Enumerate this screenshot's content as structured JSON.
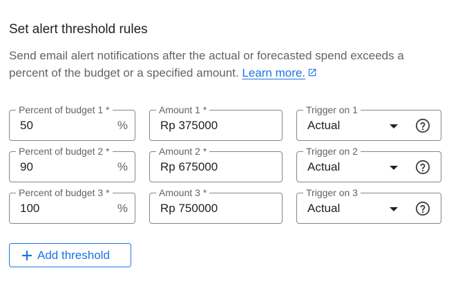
{
  "heading": "Set alert threshold rules",
  "description": "Send email alert notifications after the actual or forecasted spend exceeds a percent of the budget or a specified amount.",
  "learn_more": "Learn more.",
  "rows": [
    {
      "percent_label": "Percent of budget 1 *",
      "percent_value": "50",
      "percent_suffix": "%",
      "amount_label": "Amount 1 *",
      "amount_value": "Rp 375000",
      "trigger_label": "Trigger on 1",
      "trigger_value": "Actual"
    },
    {
      "percent_label": "Percent of budget 2 *",
      "percent_value": "90",
      "percent_suffix": "%",
      "amount_label": "Amount 2 *",
      "amount_value": "Rp 675000",
      "trigger_label": "Trigger on 2",
      "trigger_value": "Actual"
    },
    {
      "percent_label": "Percent of budget 3 *",
      "percent_value": "100",
      "percent_suffix": "%",
      "amount_label": "Amount 3 *",
      "amount_value": "Rp 750000",
      "trigger_label": "Trigger on 3",
      "trigger_value": "Actual"
    }
  ],
  "add_button": "Add threshold",
  "icons": {
    "external": "external-link-icon",
    "help": "help-circle-icon",
    "dropdown": "dropdown-arrow-icon",
    "add": "plus-icon"
  },
  "colors": {
    "accent": "#1a73e8",
    "text": "#202124",
    "muted": "#5f6368",
    "border": "#80868b"
  }
}
